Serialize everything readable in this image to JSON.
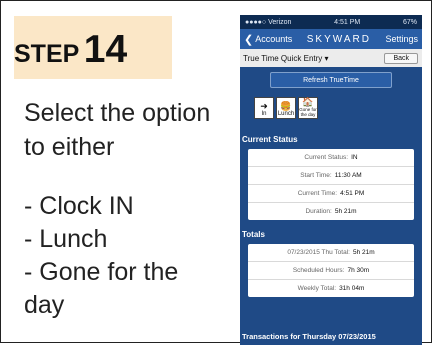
{
  "slide": {
    "step_word": "STEP",
    "step_number": "14",
    "instruction_line1": "Select the option",
    "instruction_line2": "to either",
    "options": [
      "- Clock IN",
      "- Lunch",
      "- Gone for the",
      "day"
    ]
  },
  "phone": {
    "status_bar": {
      "carrier": "●●●●○ Verizon",
      "time": "4:51 PM",
      "battery": "67%"
    },
    "nav": {
      "back_label": "Accounts",
      "logo": "SKYWARD",
      "settings_label": "Settings"
    },
    "quick_entry": {
      "label": "True Time Quick Entry ▾",
      "back_button": "Back"
    },
    "refresh_button": "Refresh TrueTime",
    "actions": [
      {
        "name": "clock-in-icon",
        "label": "In",
        "glyph": "➜"
      },
      {
        "name": "lunch-icon",
        "label": "Lunch",
        "glyph": "🍔"
      },
      {
        "name": "gone-for-day-icon",
        "label": "Gone for the day",
        "glyph": "🏠"
      }
    ],
    "current_status": {
      "title": "Current Status",
      "rows": [
        {
          "k": "Current Status:",
          "v": "IN"
        },
        {
          "k": "Start Time:",
          "v": "11:30 AM"
        },
        {
          "k": "Current Time:",
          "v": "4:51 PM"
        },
        {
          "k": "Duration:",
          "v": "5h 21m"
        }
      ]
    },
    "totals": {
      "title": "Totals",
      "rows": [
        {
          "k": "07/23/2015 Thu Total:",
          "v": "5h 21m"
        },
        {
          "k": "Scheduled Hours:",
          "v": "7h 30m"
        },
        {
          "k": "Weekly Total:",
          "v": "31h 04m"
        }
      ]
    },
    "transactions_title": "Transactions for Thursday 07/23/2015"
  }
}
